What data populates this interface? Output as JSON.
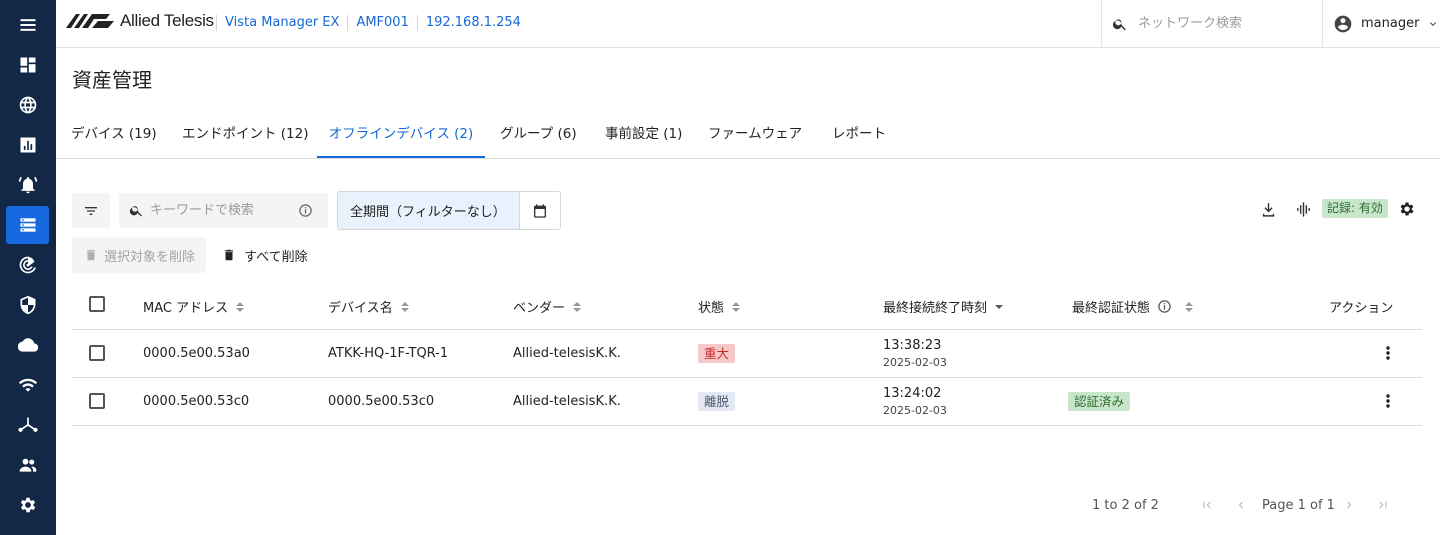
{
  "header": {
    "brand": "Allied Telesis",
    "breadcrumbs": [
      "Vista Manager EX",
      "AMF001",
      "192.168.1.254"
    ],
    "search_placeholder": "ネットワーク検索",
    "user": "manager"
  },
  "sidebar": {
    "items": [
      "menu-icon",
      "dashboard-icon",
      "globe-icon",
      "chart-icon",
      "alarm-icon",
      "asset-list-icon",
      "radar-icon",
      "shield-icon",
      "cloud-icon",
      "wifi-icon",
      "topology-icon",
      "users-icon",
      "gear-icon"
    ],
    "active_index": 5
  },
  "page": {
    "title": "資産管理"
  },
  "tabs": [
    {
      "label": "デバイス (19)"
    },
    {
      "label": "エンドポイント (12)"
    },
    {
      "label": "オフラインデバイス (2)"
    },
    {
      "label": "グループ (6)"
    },
    {
      "label": "事前設定 (1)"
    },
    {
      "label": "ファームウェア"
    },
    {
      "label": "レポート"
    }
  ],
  "active_tab": 2,
  "toolbar": {
    "keyword_placeholder": "キーワードで検索",
    "period_label": "全期間（フィルターなし）",
    "record_badge": "記録: 有効",
    "delete_selected": "選択対象を削除",
    "delete_all": "すべて削除"
  },
  "table": {
    "columns": [
      "MAC アドレス",
      "デバイス名",
      "ベンダー",
      "状態",
      "最終接続終了時刻",
      "最終認証状態",
      "アクション"
    ],
    "rows": [
      {
        "mac": "0000.5e00.53a0",
        "name": "ATKK-HQ-1F-TQR-1",
        "vendor": "Allied-telesisK.K.",
        "status": "重大",
        "status_color": "#f8c7c7",
        "status_text_color": "#c62828",
        "time": "13:38:23",
        "date": "2025-02-03",
        "auth": ""
      },
      {
        "mac": "0000.5e00.53c0",
        "name": "0000.5e00.53c0",
        "vendor": "Allied-telesisK.K.",
        "status": "離脱",
        "status_color": "#e3e8f2",
        "status_text_color": "#4a5870",
        "time": "13:24:02",
        "date": "2025-02-03",
        "auth": "認証済み"
      }
    ]
  },
  "pagination": {
    "summary": "1 to 2 of 2",
    "page": "Page 1 of 1"
  },
  "colors": {
    "sidebar": "#132846",
    "accent": "#1668d6",
    "badge_green": "#c8e6c9"
  }
}
